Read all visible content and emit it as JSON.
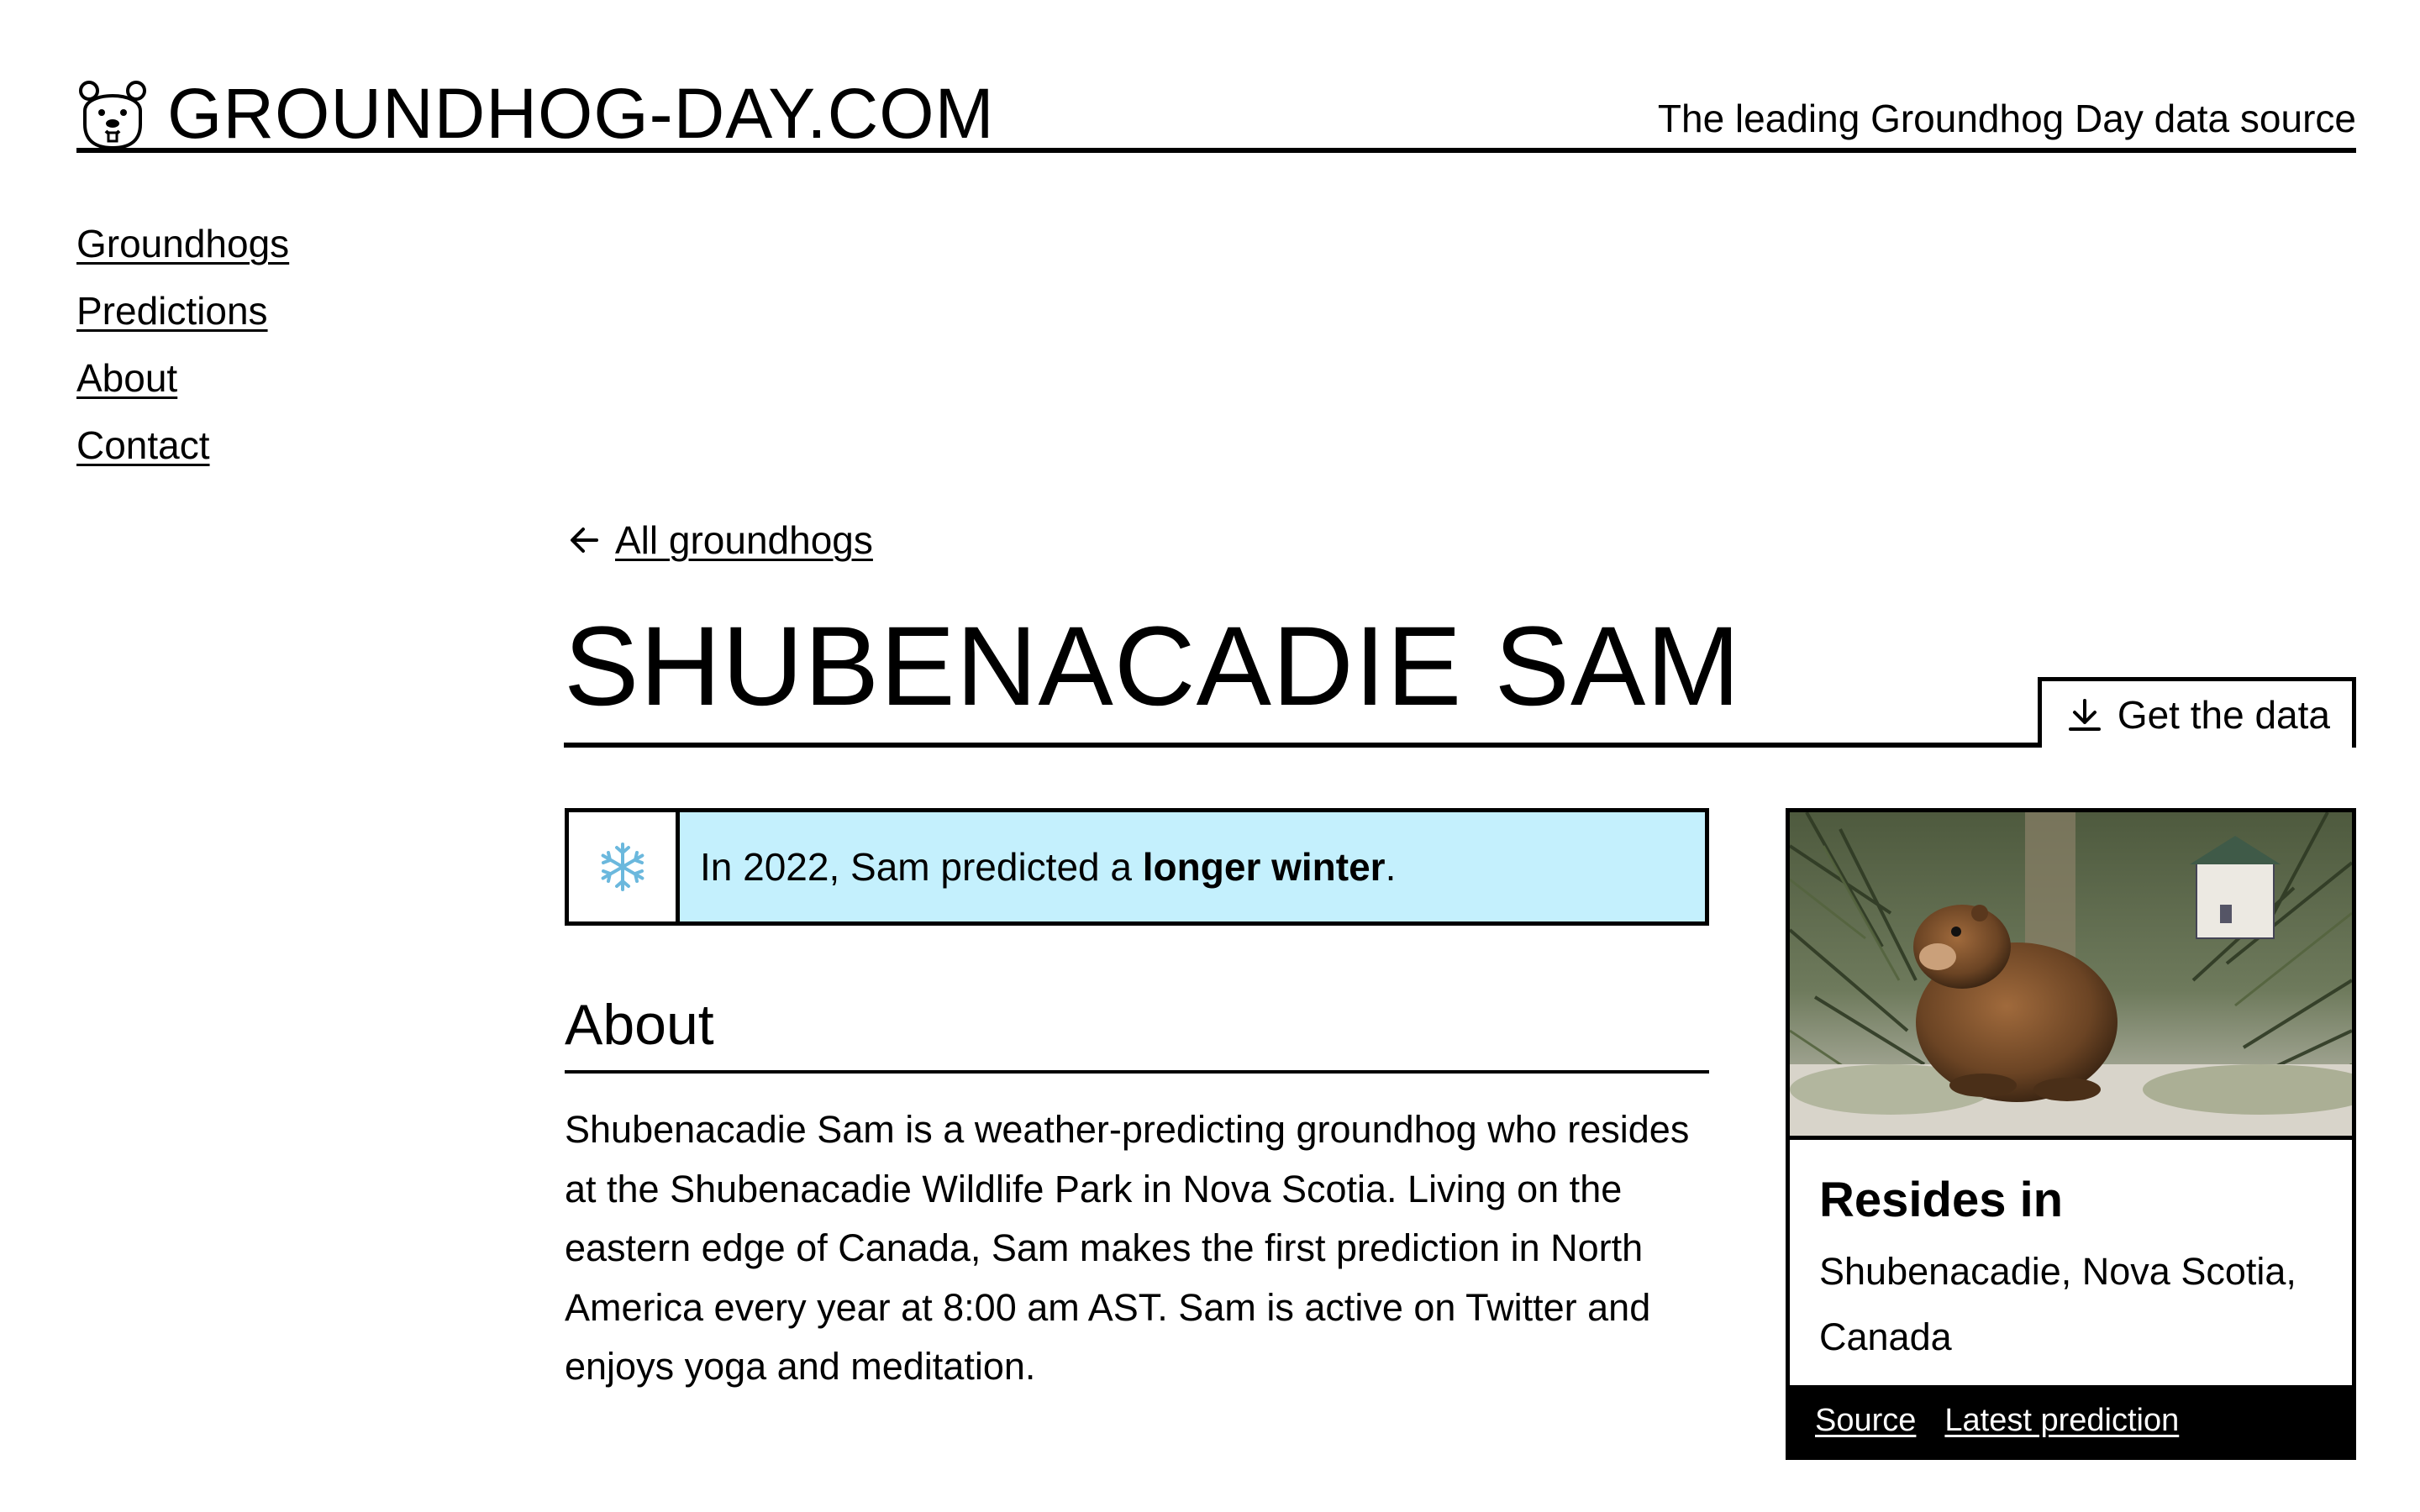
{
  "header": {
    "logo_text": "GROUNDHOG-DAY.COM",
    "logo_icon": "groundhog-face-icon",
    "tagline": "The leading Groundhog Day data source"
  },
  "nav": {
    "items": [
      "Groundhogs",
      "Predictions",
      "About",
      "Contact"
    ]
  },
  "breadcrumb": {
    "back_icon": "arrow-left-icon",
    "back_label": "All groundhogs"
  },
  "page": {
    "title": "SHUBENACADIE SAM",
    "get_data_label": "Get the data",
    "get_data_icon": "download-icon"
  },
  "prediction": {
    "icon": "snowflake-icon",
    "text_prefix": "In 2022, Sam predicted a ",
    "text_bold": "longer winter",
    "text_suffix": ".",
    "background_color": "#c4f0fd"
  },
  "about": {
    "heading": "About",
    "body": "Shubenacadie Sam is a weather-predicting groundhog who resides at the Shubenacadie Wildlife Park in Nova Scotia. Living on the eastern edge of Canada, Sam makes the first prediction in North America every year at 8:00 am AST. Sam is active on Twitter and enjoys yoga and meditation."
  },
  "card": {
    "image": "groundhog-photo",
    "resides_heading": "Resides in",
    "resides_value": "Shubenacadie, Nova Scotia, Canada",
    "links": [
      "Source",
      "Latest prediction"
    ]
  }
}
